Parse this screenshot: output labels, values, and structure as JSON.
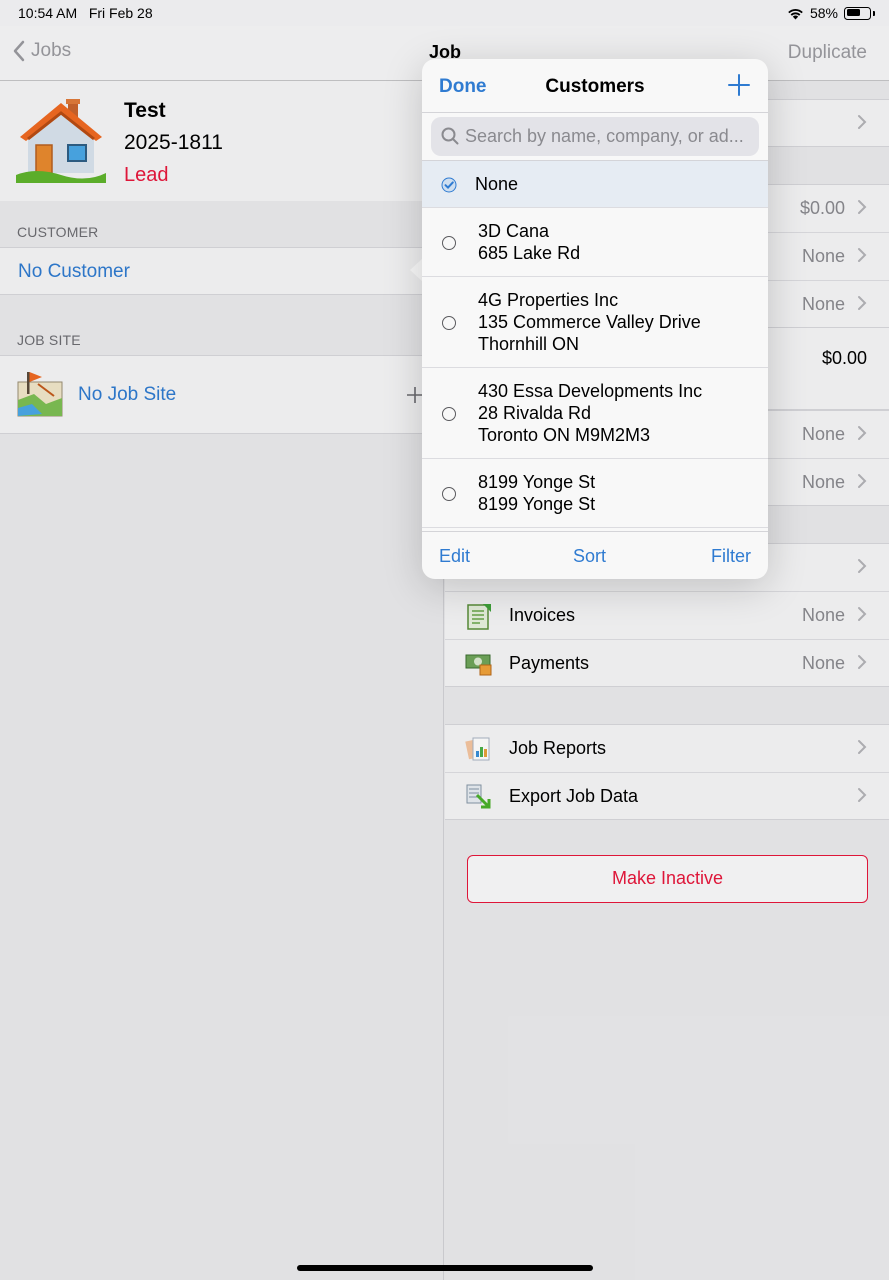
{
  "status_bar": {
    "time": "10:54 AM",
    "date": "Fri Feb 28",
    "battery": "58%"
  },
  "navbar": {
    "back_label": "Jobs",
    "title": "Job",
    "duplicate_label": "Duplicate"
  },
  "job": {
    "name": "Test",
    "number": "2025-1811",
    "status": "Lead",
    "status_color": "#e8173c"
  },
  "customer_section": {
    "label": "CUSTOMER",
    "value": "No Customer"
  },
  "job_site_section": {
    "label": "JOB SITE",
    "value": "No Job Site"
  },
  "right_values": {
    "row1": "$0.00",
    "row2": "None",
    "row3": "None",
    "total": "$0.00",
    "row5": "None",
    "row6": "None"
  },
  "right_rows": [
    {
      "label": "Invoices",
      "value": "None"
    },
    {
      "label": "Payments",
      "value": "None"
    }
  ],
  "report_rows": [
    {
      "label": "Job Reports"
    },
    {
      "label": "Export Job Data"
    }
  ],
  "make_inactive": "Make Inactive",
  "popover": {
    "done": "Done",
    "title": "Customers",
    "search_placeholder": "Search by name, company, or ad...",
    "items": [
      {
        "lines": [
          "None"
        ],
        "selected": true
      },
      {
        "lines": [
          "3D Cana",
          "685 Lake Rd"
        ],
        "selected": false
      },
      {
        "lines": [
          "4G Properties Inc",
          "135 Commerce Valley Drive",
          "Thornhill ON"
        ],
        "selected": false
      },
      {
        "lines": [
          "430 Essa Developments Inc",
          "28 Rivalda Rd",
          "Toronto ON M9M2M3"
        ],
        "selected": false
      },
      {
        "lines": [
          "8199 Yonge St",
          "8199 Yonge St"
        ],
        "selected": false
      }
    ],
    "footer": {
      "edit": "Edit",
      "sort": "Sort",
      "filter": "Filter"
    }
  },
  "colors": {
    "accent": "#2f7bd1",
    "destructive": "#e8173c"
  }
}
